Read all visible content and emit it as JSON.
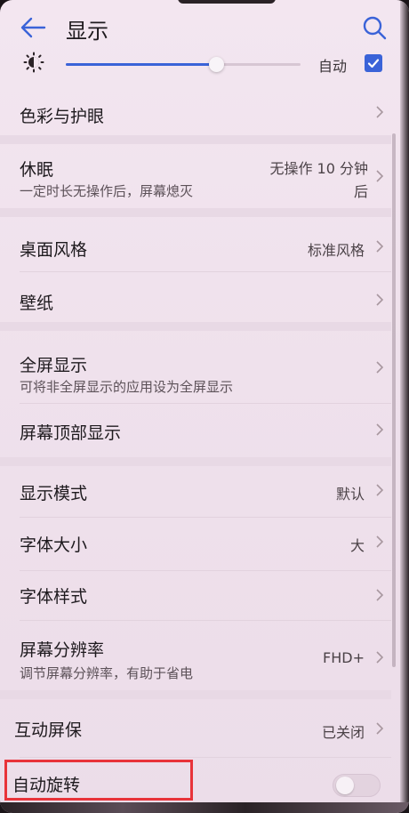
{
  "header": {
    "title": "显示"
  },
  "brightness": {
    "level_percent": 64,
    "auto_label": "自动",
    "auto_checked": true
  },
  "items": [
    {
      "label": "色彩与护眼"
    },
    {
      "label": "休眠",
      "sub": "一定时长无操作后，屏幕熄灭",
      "value_line1": "无操作 10 分钟",
      "value_line2": "后"
    },
    {
      "label": "桌面风格",
      "value": "标准风格"
    },
    {
      "label": "壁纸"
    },
    {
      "label": "全屏显示",
      "sub": "可将非全屏显示的应用设为全屏显示"
    },
    {
      "label": "屏幕顶部显示"
    },
    {
      "label": "显示模式",
      "value": "默认"
    },
    {
      "label": "字体大小",
      "value": "大"
    },
    {
      "label": "字体样式"
    },
    {
      "label": "屏幕分辨率",
      "sub": "调节屏幕分辨率，有助于省电",
      "value": "FHD+"
    },
    {
      "label": "互动屏保",
      "value": "已关闭"
    },
    {
      "label": "自动旋转",
      "toggle_on": false
    }
  ],
  "colors": {
    "accent": "#3a63d8",
    "highlight": "#e8333a"
  }
}
